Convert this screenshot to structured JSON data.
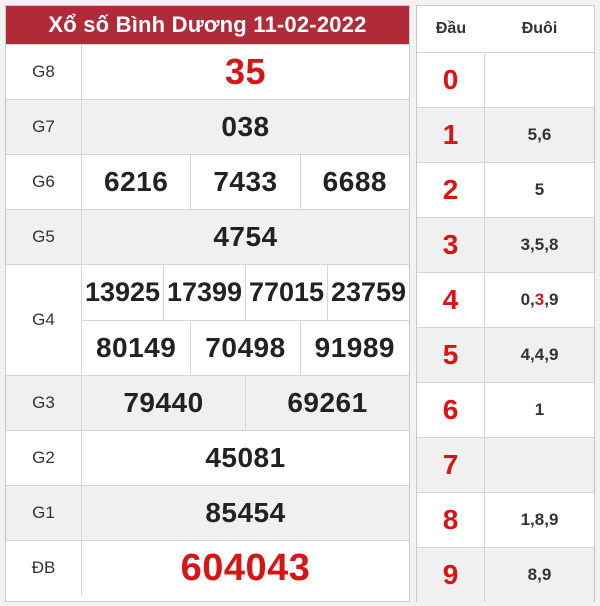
{
  "title": "Xổ số Bình Dương 11-02-2022",
  "prizes": {
    "g8": {
      "label": "G8",
      "numbers": [
        "35"
      ]
    },
    "g7": {
      "label": "G7",
      "numbers": [
        "038"
      ]
    },
    "g6": {
      "label": "G6",
      "numbers": [
        "6216",
        "7433",
        "6688"
      ]
    },
    "g5": {
      "label": "G5",
      "numbers": [
        "4754"
      ]
    },
    "g4": {
      "label": "G4",
      "numbers": [
        "13925",
        "17399",
        "77015",
        "23759",
        "80149",
        "70498",
        "91989"
      ]
    },
    "g3": {
      "label": "G3",
      "numbers": [
        "79440",
        "69261"
      ]
    },
    "g2": {
      "label": "G2",
      "numbers": [
        "45081"
      ]
    },
    "g1": {
      "label": "G1",
      "numbers": [
        "85454"
      ]
    },
    "db": {
      "label": "ĐB",
      "numbers": [
        "604043"
      ]
    }
  },
  "loto": {
    "headers": {
      "dau": "Đầu",
      "duoi": "Đuôi"
    },
    "rows": [
      {
        "dau": "0",
        "duoi": ""
      },
      {
        "dau": "1",
        "duoi": "5,6"
      },
      {
        "dau": "2",
        "duoi": "5"
      },
      {
        "dau": "3",
        "duoi": "3,5,8"
      },
      {
        "dau": "4",
        "duoi_parts": [
          "0,",
          "3",
          ",9"
        ]
      },
      {
        "dau": "5",
        "duoi": "4,4,9"
      },
      {
        "dau": "6",
        "duoi": "1"
      },
      {
        "dau": "7",
        "duoi": ""
      },
      {
        "dau": "8",
        "duoi": "1,8,9"
      },
      {
        "dau": "9",
        "duoi": "8,9"
      }
    ]
  },
  "colors": {
    "header_bg": "#b02a37",
    "highlight": "#d81414"
  }
}
